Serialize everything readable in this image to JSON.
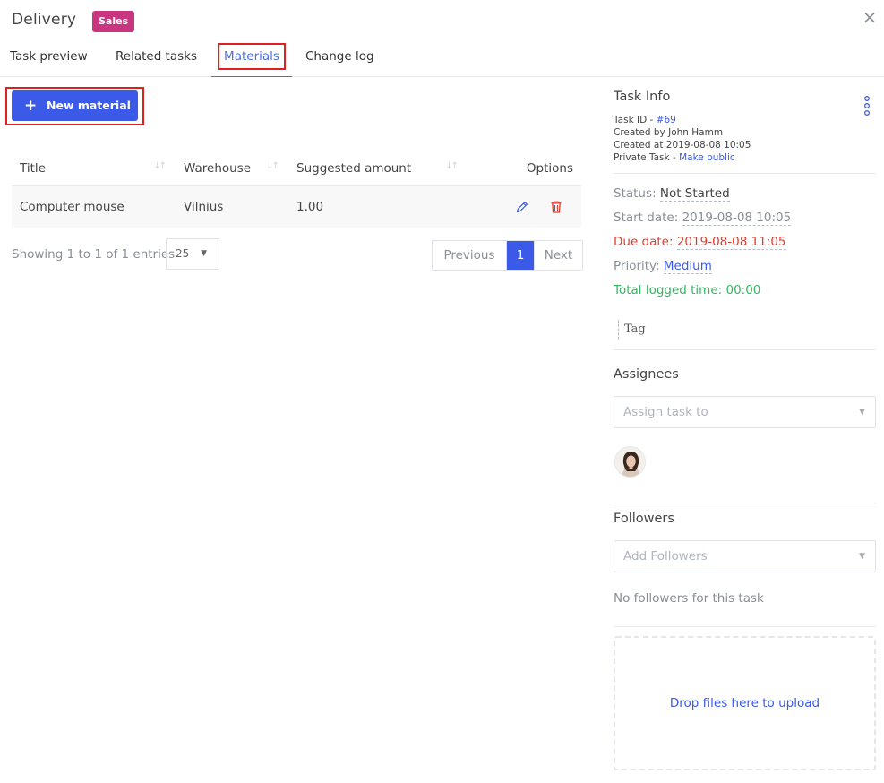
{
  "header": {
    "title": "Delivery",
    "badge": "Sales",
    "close_symbol": "×"
  },
  "tabs": [
    {
      "label": "Task preview"
    },
    {
      "label": "Related tasks"
    },
    {
      "label": "Materials",
      "active": true
    },
    {
      "label": "Change log"
    }
  ],
  "materials": {
    "new_button_label": "New material",
    "new_button_icon": "plus-icon",
    "columns": [
      "Title",
      "Warehouse",
      "Suggested amount",
      "Options"
    ],
    "rows": [
      {
        "title": "Computer mouse",
        "warehouse": "Vilnius",
        "amount": "1.00"
      }
    ],
    "showing": "Showing 1 to 1 of 1 entries",
    "page_size": "25",
    "pagination": {
      "previous": "Previous",
      "current": "1",
      "next": "Next"
    }
  },
  "task_info": {
    "title": "Task Info",
    "task_id_label": "Task ID - ",
    "task_id": "#69",
    "created_by": "Created by John Hamm",
    "created_at": "Created at 2019-08-08 10:05",
    "private_label": "Private Task - ",
    "make_public": "Make public",
    "status_label": "Status: ",
    "status": "Not Started",
    "start_label": "Start date: ",
    "start_date": "2019-08-08 10:05",
    "due_label": "Due date: ",
    "due_date": "2019-08-08 11:05",
    "priority_label": "Priority: ",
    "priority": "Medium",
    "logged_time": "Total logged time: 00:00",
    "tag_placeholder": "Tag"
  },
  "assignees": {
    "title": "Assignees",
    "placeholder": "Assign task to"
  },
  "followers": {
    "title": "Followers",
    "placeholder": "Add Followers",
    "empty": "No followers for this task"
  },
  "upload": {
    "label": "Drop files here to upload"
  },
  "colors": {
    "primary": "#3c5ae8",
    "badge": "#c8367f",
    "danger": "#e03c31",
    "success": "#35b562",
    "highlight": "#e02020"
  }
}
